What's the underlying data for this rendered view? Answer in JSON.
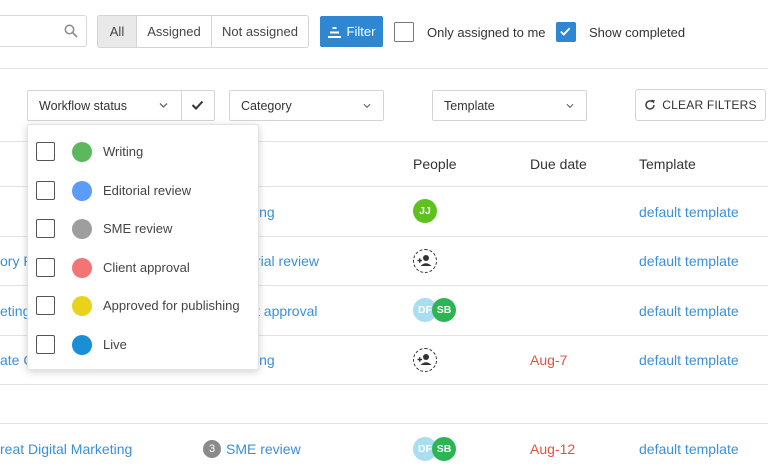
{
  "toolbar": {
    "assignment_tabs": [
      "All",
      "Assigned",
      "Not assigned"
    ],
    "filter_label": "Filter",
    "only_assigned_label": "Only assigned to me",
    "only_assigned_checked": false,
    "show_completed_label": "Show completed",
    "show_completed_checked": true
  },
  "filters": {
    "workflow_status": "Workflow status",
    "category": "Category",
    "template": "Template",
    "clear_label": "CLEAR FILTERS"
  },
  "table": {
    "headers": {
      "people": "People",
      "due_date": "Due date",
      "template": "Template"
    },
    "rows": [
      {
        "title": "",
        "status": "ing",
        "people": [
          "JJ"
        ],
        "due": "",
        "template": "default template"
      },
      {
        "title": "ory P",
        "status": "rial review",
        "people": [],
        "due": "",
        "template": "default template"
      },
      {
        "title": "eting",
        "status": "t approval",
        "people": [
          "DF",
          "SB"
        ],
        "due": "",
        "template": "default template"
      },
      {
        "title": "ate C",
        "status": "ing",
        "people": [],
        "due": "Aug-7",
        "template": "default template"
      },
      {
        "title": "reat Digital Marketing",
        "status_count": "3",
        "status": "SME review",
        "people": [
          "DF",
          "SB"
        ],
        "due": "Aug-12",
        "template": "default template"
      }
    ]
  },
  "workflow_dropdown": {
    "items": [
      {
        "label": "Writing",
        "color": "#5cb85c"
      },
      {
        "label": "Editorial review",
        "color": "#5b9cf6"
      },
      {
        "label": "SME review",
        "color": "#9e9e9e"
      },
      {
        "label": "Client approval",
        "color": "#f47474"
      },
      {
        "label": "Approved for publishing",
        "color": "#e8d21c"
      },
      {
        "label": "Live",
        "color": "#1a8fd6"
      }
    ]
  },
  "colors": {
    "accent": "#2f87d1",
    "link": "#3b8fd9",
    "overdue": "#e0533d"
  }
}
